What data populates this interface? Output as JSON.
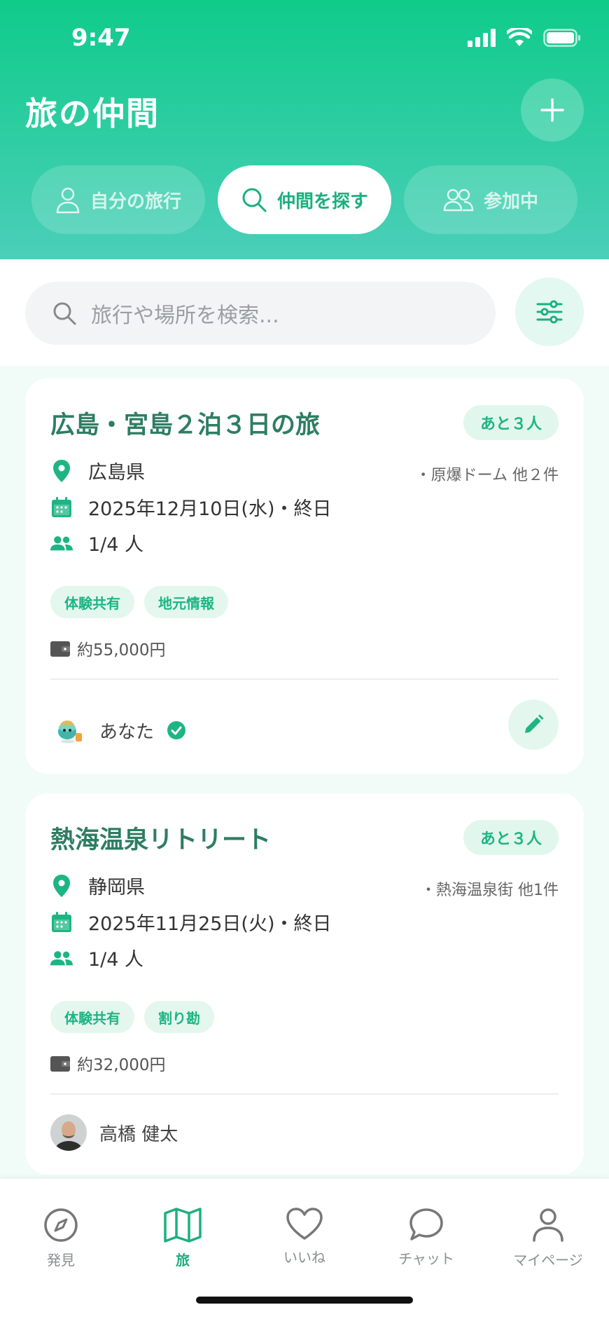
{
  "status": {
    "time": "9:47"
  },
  "header": {
    "title": "旅の仲間"
  },
  "tabs": [
    {
      "label": "自分の旅行",
      "active": false
    },
    {
      "label": "仲間を探す",
      "active": true
    },
    {
      "label": "参加中",
      "active": false
    }
  ],
  "search": {
    "placeholder": "旅行や場所を検索..."
  },
  "trips": [
    {
      "title": "広島・宮島２泊３日の旅",
      "remaining": "あと３人",
      "location": "広島県",
      "spots": "・原爆ドーム 他２件",
      "date": "2025年12月10日(水)・終日",
      "members": "1/4 人",
      "tags": [
        "体験共有",
        "地元情報"
      ],
      "price": "約55,000円",
      "owner": "あなた",
      "owner_verified": true
    },
    {
      "title": "熱海温泉リトリート",
      "remaining": "あと３人",
      "location": "静岡県",
      "spots": "・熱海温泉街 他1件",
      "date": "2025年11月25日(火)・終日",
      "members": "1/4 人",
      "tags": [
        "体験共有",
        "割り勘"
      ],
      "price": "約32,000円",
      "owner": "高橋 健太"
    }
  ],
  "nav": [
    {
      "label": "発見",
      "icon": "compass-icon",
      "active": false
    },
    {
      "label": "旅",
      "icon": "map-icon",
      "active": true
    },
    {
      "label": "いいね",
      "icon": "heart-icon",
      "active": false
    },
    {
      "label": "チャット",
      "icon": "chat-icon",
      "active": false
    },
    {
      "label": "マイページ",
      "icon": "user-icon",
      "active": false
    }
  ],
  "colors": {
    "accent": "#1BB07E",
    "header_top": "#0FCB8A",
    "header_bottom": "#4BCFB9",
    "title": "#2E7D63"
  }
}
